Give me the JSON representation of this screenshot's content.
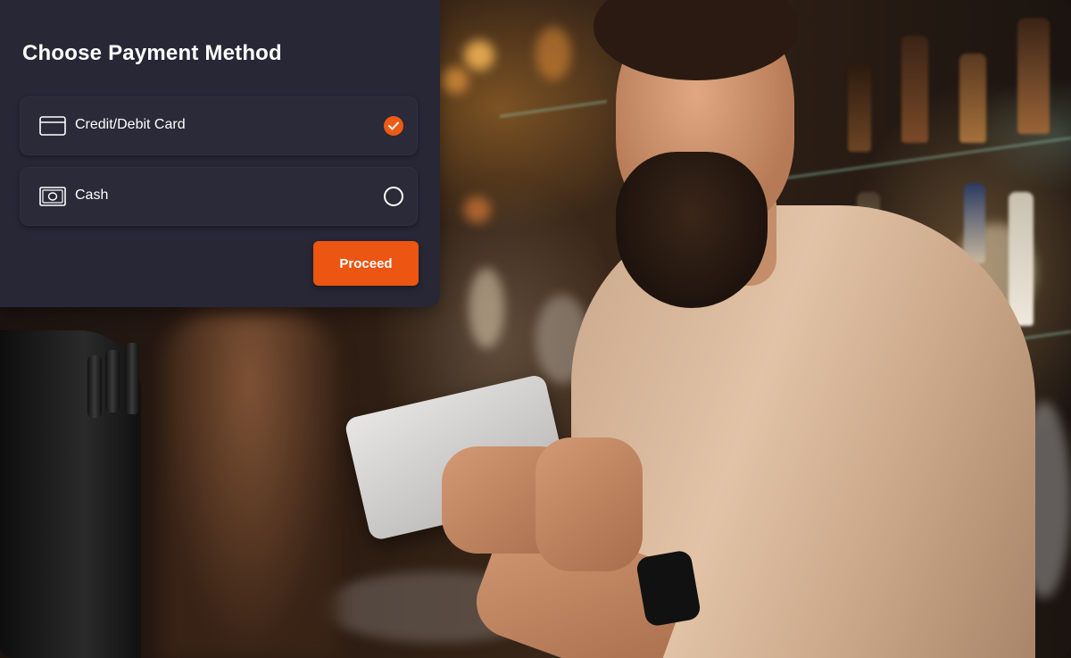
{
  "payment_panel": {
    "title": "Choose Payment Method",
    "options": [
      {
        "label": "Credit/Debit Card",
        "icon": "credit-card-icon",
        "selected": true
      },
      {
        "label": "Cash",
        "icon": "cash-icon",
        "selected": false
      }
    ],
    "proceed_label": "Proceed",
    "accent_color": "#EC5512",
    "panel_color": "#272736"
  },
  "background": {
    "description_icon": "bartender-photo"
  }
}
